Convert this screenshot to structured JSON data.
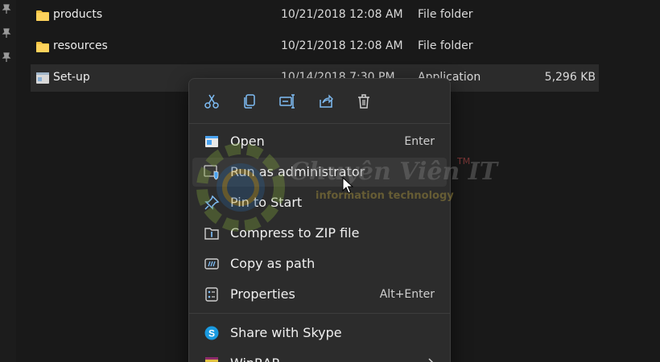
{
  "files": [
    {
      "name": "products",
      "date": "10/21/2018 12:08 AM",
      "type": "File folder",
      "size": "",
      "icon": "folder-icon"
    },
    {
      "name": "resources",
      "date": "10/21/2018 12:08 AM",
      "type": "File folder",
      "size": "",
      "icon": "folder-icon"
    },
    {
      "name": "Set-up",
      "date": "10/14/2018 7:30 PM",
      "type": "Application",
      "size": "5,296 KB",
      "icon": "application-icon"
    }
  ],
  "quick_actions": [
    {
      "name": "cut",
      "icon": "scissors-icon"
    },
    {
      "name": "copy",
      "icon": "copy-icon"
    },
    {
      "name": "rename",
      "icon": "rename-icon"
    },
    {
      "name": "share",
      "icon": "share-icon"
    },
    {
      "name": "delete",
      "icon": "trash-icon"
    }
  ],
  "menu": {
    "open": {
      "label": "Open",
      "shortcut": "Enter"
    },
    "run_as_admin": {
      "label": "Run as administrator"
    },
    "pin_to_start": {
      "label": "Pin to Start"
    },
    "compress_zip": {
      "label": "Compress to ZIP file"
    },
    "copy_as_path": {
      "label": "Copy as path"
    },
    "properties": {
      "label": "Properties",
      "shortcut": "Alt+Enter"
    },
    "share_skype": {
      "label": "Share with Skype"
    },
    "winrar": {
      "label": "WinRAR"
    }
  },
  "watermark": {
    "title": "Chuyên Viên IT",
    "tm": "TM",
    "subtitle": "information technology"
  },
  "colors": {
    "folder": "#f4c342",
    "accent_blue": "#4aa3f0",
    "skype": "#1a9ae0",
    "background": "#191919",
    "menu_bg": "#2c2c2c"
  }
}
